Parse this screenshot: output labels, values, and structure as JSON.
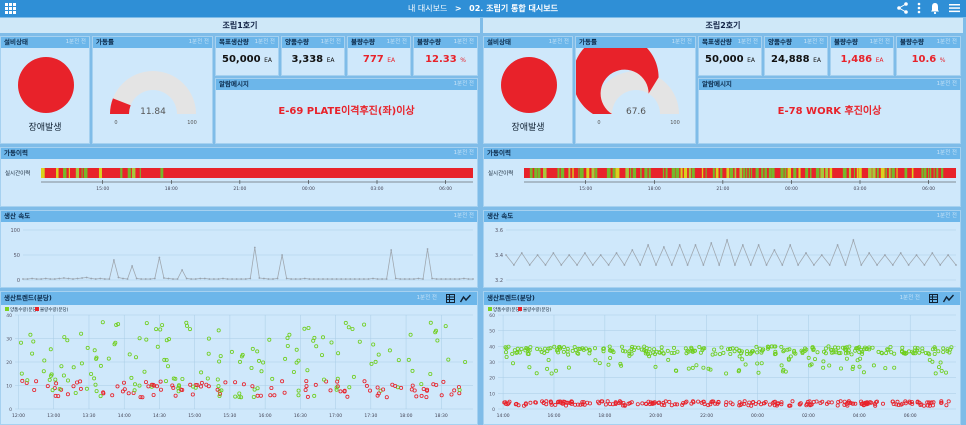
{
  "topbar": {
    "home": "내 대시보드",
    "sep": ">",
    "page": "02. 조립기 통합 대시보드",
    "share_icon": "share-icon",
    "more_icon": "more-vert-icon",
    "bell_icon": "bell-icon",
    "menu_icon": "menu-icon",
    "grid_icon": "grid-icon"
  },
  "colors": {
    "topbar": "#2f8fd6",
    "header": "#6cb6ea",
    "red": "#e8222a",
    "green": "#7ed321",
    "box": "#cfe8fb"
  },
  "panels": [
    {
      "title": "조립1호기",
      "status": {
        "label": "설비상태",
        "tag": "1분전 전",
        "text": "장애발생"
      },
      "gauge": {
        "label": "가동률",
        "tag": "1분전 전",
        "value": "11.84",
        "min": "0",
        "max": "100",
        "fraction": 0.1184
      },
      "kpis": [
        {
          "label": "목표생산량",
          "tag": "1분전 전",
          "value": "50,000",
          "unit": "EA",
          "color": "#111"
        },
        {
          "label": "양품수량",
          "tag": "1분전 전",
          "value": "3,338",
          "unit": "EA",
          "color": "#111"
        },
        {
          "label": "불량수량",
          "tag": "1분전 전",
          "value": "777",
          "unit": "EA",
          "color": "#e8222a"
        },
        {
          "label": "불량수량",
          "tag": "1분전 전",
          "value": "12.33",
          "unit": "%",
          "color": "#e8222a"
        }
      ],
      "alarm": {
        "label": "알람메시지",
        "tag": "1분전 전",
        "text": "E-69 PLATE이격후진(좌)이상"
      },
      "uptime": {
        "label": "가동이력",
        "tag": "1분전 전",
        "row_label": "실시간이력",
        "ticks": [
          "15:00",
          "18:00",
          "21:00",
          "00:00",
          "03:00",
          "06:00"
        ],
        "seed": 11,
        "green_share": 0.22
      },
      "speed": {
        "label": "생산 속도",
        "tag": "1분전 전",
        "yticks": [
          "100",
          "50",
          "0"
        ],
        "ymin": 0,
        "ymax": 100,
        "values": [
          2,
          2,
          3,
          2,
          2,
          3,
          2,
          2,
          3,
          4,
          3,
          2,
          3,
          4,
          5,
          3,
          2,
          3,
          2,
          2,
          40,
          5,
          3,
          2,
          28,
          3,
          2,
          2,
          2,
          3,
          45,
          4,
          3,
          2,
          2,
          20,
          3,
          2,
          2,
          3,
          3,
          2,
          2,
          2,
          3,
          2,
          2,
          2,
          2,
          2,
          3,
          65,
          4,
          3,
          2,
          2,
          3,
          50,
          3,
          2,
          2,
          2,
          3,
          2,
          2,
          2,
          2,
          2,
          2,
          2,
          2,
          2,
          2,
          2,
          2,
          2,
          2,
          3,
          2,
          2,
          2,
          60,
          3,
          2,
          2,
          2,
          2,
          3,
          2,
          62,
          3,
          2,
          2,
          2,
          2,
          2,
          2,
          3,
          2,
          2
        ]
      },
      "trend": {
        "label": "생산트렌드(분당)",
        "tag": "1분전 전",
        "legend": [
          "양품수량(분당)",
          "불량수량(분당)"
        ],
        "yticks": [
          "40",
          "30",
          "20",
          "10",
          "0"
        ],
        "ymin": 0,
        "ymax": 40,
        "xticks": [
          "12:00",
          "13:00",
          "13:30",
          "14:00",
          "14:30",
          "15:00",
          "15:30",
          "16:00",
          "16:30",
          "17:00",
          "17:30",
          "18:00",
          "18:30"
        ],
        "seed": 7,
        "good_level": 25,
        "bad_level": 5
      }
    },
    {
      "title": "조립2호기",
      "status": {
        "label": "설비상태",
        "tag": "1분전 전",
        "text": "장애발생"
      },
      "gauge": {
        "label": "가동률",
        "tag": "1분전 전",
        "value": "67.6",
        "min": "0",
        "max": "100",
        "fraction": 0.676
      },
      "kpis": [
        {
          "label": "목표생산량",
          "tag": "1분전 전",
          "value": "50,000",
          "unit": "EA",
          "color": "#111"
        },
        {
          "label": "양품수량",
          "tag": "1분전 전",
          "value": "24,888",
          "unit": "EA",
          "color": "#111"
        },
        {
          "label": "불량수량",
          "tag": "1분전 전",
          "value": "1,486",
          "unit": "EA",
          "color": "#e8222a"
        },
        {
          "label": "불량수량",
          "tag": "1분전 전",
          "value": "10.6",
          "unit": "%",
          "color": "#e8222a"
        }
      ],
      "alarm": {
        "label": "알람메시지",
        "tag": "1분전 전",
        "text": "E-78 WORK 후진이상"
      },
      "uptime": {
        "label": "가동이력",
        "tag": "1분전 전",
        "row_label": "실시간이력",
        "ticks": [
          "15:00",
          "18:00",
          "21:00",
          "00:00",
          "03:00",
          "06:00"
        ],
        "seed": 23,
        "green_share": 0.55
      },
      "speed": {
        "label": "생산 속도",
        "tag": "1분전 전",
        "yticks": [
          "3.6",
          "3.4",
          "3.2"
        ],
        "ymin": 3.15,
        "ymax": 3.65,
        "values": [
          3.4,
          3.3,
          3.42,
          3.3,
          3.4,
          3.3,
          3.42,
          3.3,
          3.4,
          3.3,
          3.42,
          3.3,
          3.4,
          3.3,
          3.42,
          3.3,
          3.45,
          3.3,
          3.5,
          3.3,
          3.48,
          3.3,
          3.5,
          3.3,
          3.5,
          3.3,
          3.52,
          3.3,
          3.55,
          3.3,
          3.5,
          3.3,
          3.5,
          3.3,
          3.45,
          3.3,
          3.5,
          3.3,
          3.42,
          3.3,
          3.4,
          3.3,
          3.5,
          3.3,
          3.55,
          3.3,
          3.42,
          3.3,
          3.4,
          3.3,
          3.42,
          3.3,
          3.4,
          3.3,
          3.42,
          3.3,
          3.4,
          3.3
        ]
      },
      "trend": {
        "label": "생산트렌드(분당)",
        "tag": "1분전 전",
        "legend": [
          "양품수량(분당)",
          "불량수량(분당)"
        ],
        "yticks": [
          "60",
          "50",
          "40",
          "30",
          "20",
          "10",
          "0"
        ],
        "ymin": 0,
        "ymax": 60,
        "xticks": [
          "14:00",
          "16:00",
          "18:00",
          "20:00",
          "22:00",
          "00:00",
          "02:00",
          "04:00",
          "06:00"
        ],
        "seed": 5,
        "good_level": 35,
        "bad_level": 2
      }
    }
  ]
}
